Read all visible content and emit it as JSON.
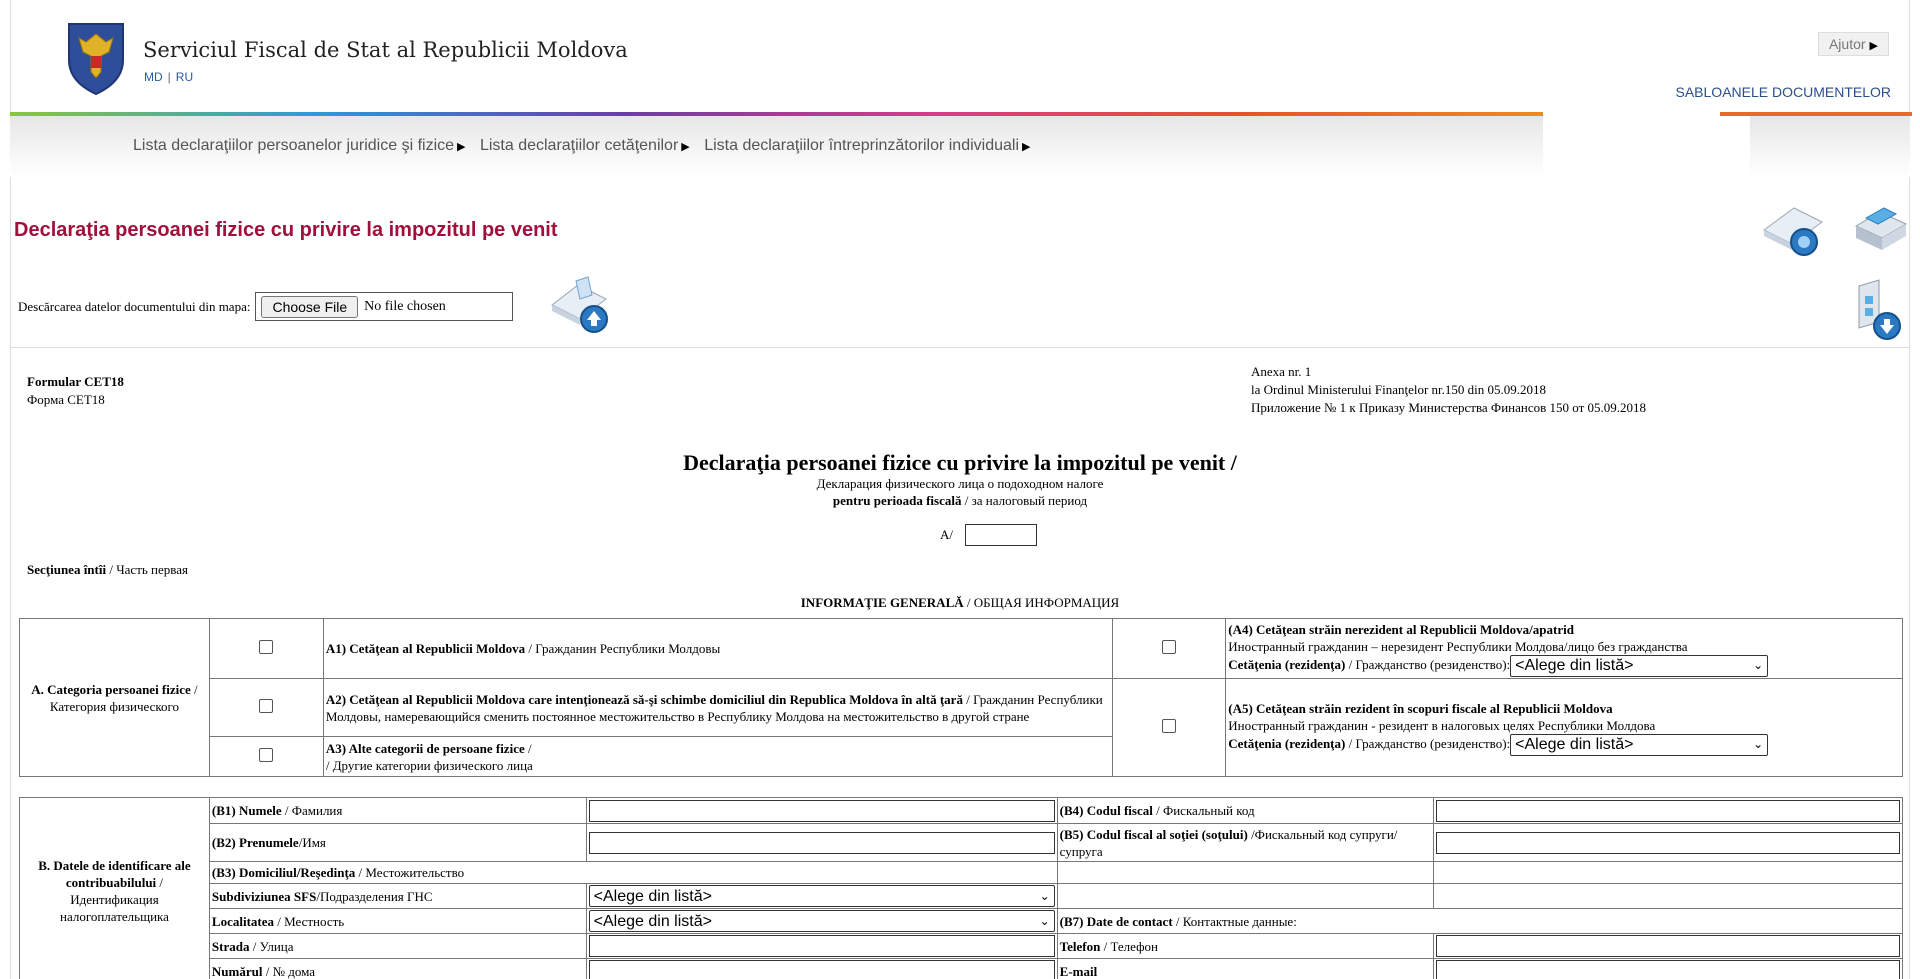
{
  "header": {
    "site_title": "Serviciul Fiscal de Stat al Republicii Moldova",
    "lang_md": "MD",
    "lang_sep": "|",
    "lang_ru": "RU",
    "help_label": "Ajutor",
    "templates_label": "SABLOANELE DOCUMENTELOR",
    "accent_color": "#a0103a",
    "link_color": "#2a4f8a"
  },
  "nav": {
    "items": [
      {
        "label": "Lista declaraţiilor persoanelor juridice şi fizice"
      },
      {
        "label": "Lista declaraţiilor cetăţenilor"
      },
      {
        "label": "Lista declaraţiilor întreprinzătorilor individuali"
      }
    ]
  },
  "page": {
    "doc_title": "Declaraţia persoanei fizice cu privire la impozitul pe venit",
    "upload_label": "Descărcarea datelor documentului din mapa:",
    "file_button": "Choose File",
    "file_status": "No file chosen"
  },
  "form": {
    "form_code_ro": "Formular CET18",
    "form_code_ru": "Форма CET18",
    "annex_1": "Anexa nr. 1",
    "annex_2": "la Ordinul Ministerului Finanţelor nr.150 din 05.09.2018",
    "annex_3": "Приложение № 1 к Приказу Министерства Финансов 150 от 05.09.2018",
    "title": "Declaraţia persoanei fizice cu privire la impozitul pe venit /",
    "subtitle_ru": "Декларация физического лица о подоходном налоге",
    "period_bold": "pentru perioada fiscală",
    "period_ru": " / за налоговый период",
    "period_prefix": "A/",
    "section1_bold": "Secţiunea întîi",
    "section1_ru": " / Часть первая",
    "general_bold": "INFORMAŢIE GENERALĂ",
    "general_ru": " / ОБЩАЯ ИНФОРМАЦИЯ"
  },
  "sectionA": {
    "label_bold": "A. Categoria persoanei fizice",
    "label_sep": " /",
    "label_ru": "Категория физического",
    "a1_bold": "A1) Cetăţean al Republicii Moldova",
    "a1_ru": " / Гражданин Республики Молдовы",
    "a2_bold": "A2) Cetăţean al Republicii Moldova care intenţionează să-şi schimbe domiciliul din Republica Moldova în altă ţară",
    "a2_ru": " / Гражданин Республики Молдовы, намеревающийся сменить постоянное местожительство в Республику Молдова на местожительство в другой стране",
    "a3_bold": "A3) Alte categorii de persoane fizice",
    "a3_ru": " / Другие категории физического лица",
    "a4_bold": "(A4) Cetăţean străin nerezident al Republicii Moldova/apatrid",
    "a4_ru": "Иностранный гражданин – нерезидент Республики Молдова/лицо без гражданства",
    "a5_bold": "(A5) Cetăţean străin rezident în scopuri fiscale al Republicii Moldova",
    "a5_ru": "Иностранный гражданин - резидент в налоговых целях Республики Молдова",
    "citizenship_bold": "Cetăţenia (rezidenţa)",
    "citizenship_ru": " / Гражданство (резиденство):",
    "select_default": "<Alege din listă>"
  },
  "sectionB": {
    "label_bold": "B. Datele de identificare ale contribuabilului",
    "label_sep": " /",
    "label_ru": "Идентификация налогоплательщика",
    "b1_bold": "(B1) Numele",
    "b1_ru": " / Фамилия",
    "b2_bold": "(B2) Prenumele",
    "b2_ru": "/Имя",
    "b3_bold": "(B3) Domiciliul/Reşedinţa",
    "b3_ru": " / Местожительство",
    "sfs_bold": "Subdiviziunea SFS",
    "sfs_ru": "/Подразделения ГНС",
    "loc_bold": "Localitatea",
    "loc_ru": " / Местность",
    "street_bold": "Strada",
    "street_ru": " / Улица",
    "number_bold": "Numărul",
    "number_ru": " / № дома",
    "b4_bold": "(B4) Codul fiscal",
    "b4_ru": " / Фискальный код",
    "b5_bold": "(B5) Codul fiscal al soţiei (soţului)",
    "b5_ru": " /Фискальный код супруги/супруга",
    "b7_bold": "(B7) Date de contact",
    "b7_ru": " / Контактные данные:",
    "phone_bold": "Telefon",
    "phone_ru": " / Телефон",
    "email_bold": "E-mail",
    "select_default": "<Alege din listă>"
  }
}
